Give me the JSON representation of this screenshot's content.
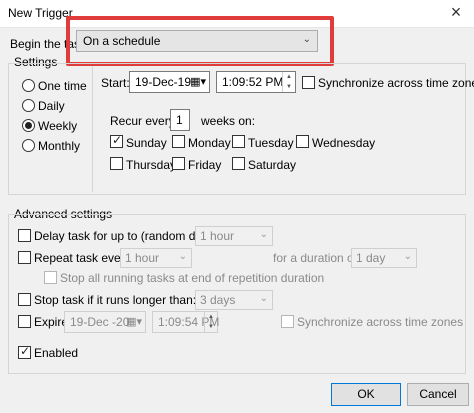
{
  "window": {
    "title": "New Trigger"
  },
  "begin": {
    "label": "Begin the task:",
    "value": "On a schedule"
  },
  "settings": {
    "group_label": "Settings",
    "radios": [
      "One time",
      "Daily",
      "Weekly",
      "Monthly"
    ],
    "selected_radio": "Weekly",
    "start_label": "Start:",
    "start_date": "19-Dec-19",
    "start_time": "1:09:52 PM",
    "sync_label": "Synchronize across time zones",
    "recur_label": "Recur every:",
    "recur_value": "1",
    "recur_suffix": "weeks on:",
    "days": [
      "Sunday",
      "Monday",
      "Tuesday",
      "Wednesday",
      "Thursday",
      "Friday",
      "Saturday"
    ],
    "checked_days": [
      "Sunday"
    ]
  },
  "advanced": {
    "group_label": "Advanced settings",
    "delay_label": "Delay task for up to (random delay):",
    "delay_value": "1 hour",
    "repeat_label": "Repeat task every:",
    "repeat_value": "1 hour",
    "duration_label": "for a duration of:",
    "duration_value": "1 day",
    "stop_all_label": "Stop all running tasks at end of repetition duration",
    "stop_longer_label": "Stop task if it runs longer than:",
    "stop_longer_value": "3 days",
    "expire_label": "Expire:",
    "expire_date": "19-Dec -20",
    "expire_time": "1:09:54 PM",
    "expire_sync_label": "Synchronize across time zones",
    "enabled_label": "Enabled"
  },
  "buttons": {
    "ok": "OK",
    "cancel": "Cancel"
  },
  "colors": {
    "highlight": "#e03c3c",
    "accent": "#0078d7"
  }
}
